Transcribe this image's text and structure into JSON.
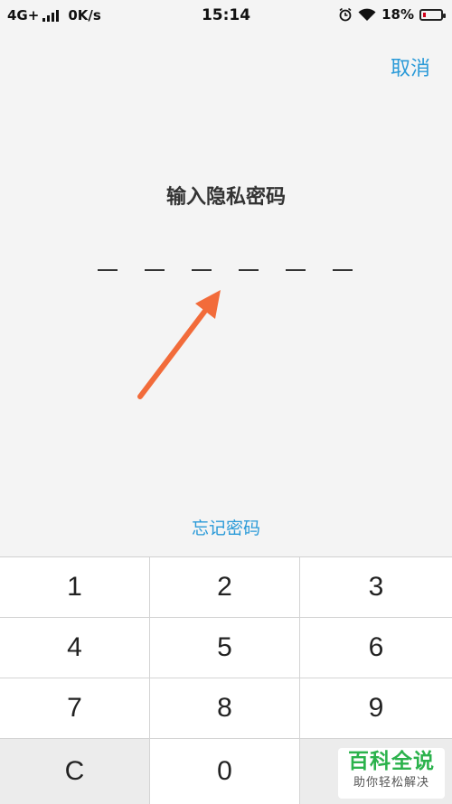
{
  "status_bar": {
    "network": "4G+",
    "speed": "0K/s",
    "time": "15:14",
    "battery": "18%",
    "icons": [
      "signal-icon",
      "alarm-icon",
      "wifi-icon",
      "battery-icon"
    ]
  },
  "header": {
    "cancel_label": "取消"
  },
  "main": {
    "title": "输入隐私密码",
    "pin_length": 6,
    "forgot_label": "忘记密码"
  },
  "keypad": {
    "keys": [
      "1",
      "2",
      "3",
      "4",
      "5",
      "6",
      "7",
      "8",
      "9",
      "C",
      "0"
    ]
  },
  "watermark": {
    "main": "百科全说",
    "sub": "助你轻松解决"
  },
  "colors": {
    "accent": "#2a9ad8",
    "arrow": "#f26b3a",
    "watermark": "#2bb24c"
  }
}
